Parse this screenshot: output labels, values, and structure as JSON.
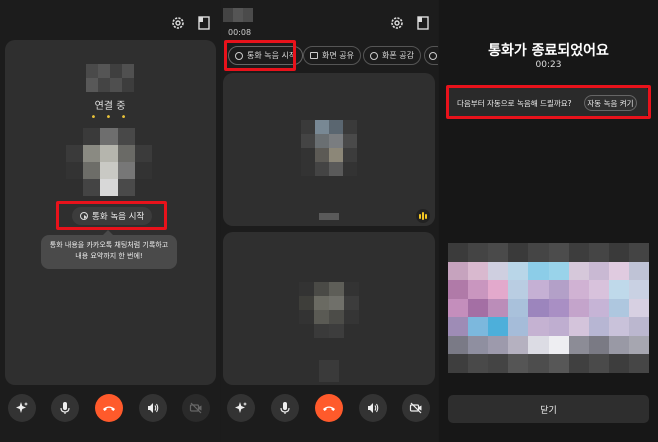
{
  "panel1": {
    "connecting_label": "연결 중",
    "dots": "• • •",
    "record_button_label": "통화 녹음 시작",
    "tooltip_line1": "통화 내용을 카카오톡 채팅처럼 기록하고",
    "tooltip_line2": "내용 요약까지 한 번에!",
    "top_icons": [
      "settings-icon",
      "screen-icon"
    ],
    "controls": [
      "sparkle-icon",
      "mic-icon",
      "end-call-icon",
      "speaker-icon",
      "video-off-icon"
    ]
  },
  "panel2": {
    "timer": "00:08",
    "chips": [
      "통화 녹음 시작",
      "화면 공유",
      "화폰 공감"
    ],
    "top_icons": [
      "settings-icon",
      "screen-icon"
    ],
    "controls": [
      "sparkle-icon",
      "mic-icon",
      "end-call-icon",
      "speaker-icon",
      "video-off-icon"
    ]
  },
  "panel3": {
    "title": "통화가 종료되었어요",
    "duration": "00:23",
    "auto_record_prompt": "다음부터 자동으로 녹음해 드릴까요?",
    "auto_record_button": "자동 녹음 켜기",
    "close_button": "닫기"
  },
  "colors": {
    "accent_red": "#e8121b",
    "end_call": "#ff5a2b",
    "dots_yellow": "#e8c23a"
  }
}
